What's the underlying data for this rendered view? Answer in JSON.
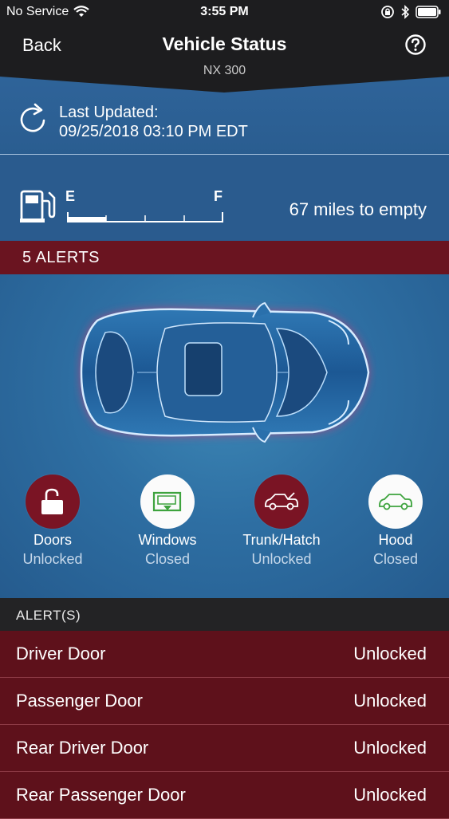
{
  "status_bar": {
    "carrier": "No Service",
    "time": "3:55 PM",
    "wifi_icon": "wifi-icon",
    "battery_icon": "battery-icon"
  },
  "header": {
    "back_label": "Back",
    "title": "Vehicle Status",
    "subtitle": "NX 300",
    "help_icon": "help-icon"
  },
  "updated": {
    "label": "Last Updated:",
    "value": "09/25/2018 03:10 PM EDT"
  },
  "fuel": {
    "empty_label": "E",
    "full_label": "F",
    "level": 0.25,
    "range_text": "67 miles to empty"
  },
  "alerts_banner": {
    "count_text": "5 ALERTS"
  },
  "statuses": [
    {
      "name": "Doors",
      "value": "Unlocked",
      "icon": "unlocked-padlock-icon",
      "state": "alert"
    },
    {
      "name": "Windows",
      "value": "Closed",
      "icon": "window-icon",
      "state": "ok"
    },
    {
      "name": "Trunk/Hatch",
      "value": "Unlocked",
      "icon": "car-trunk-icon",
      "state": "alert"
    },
    {
      "name": "Hood",
      "value": "Closed",
      "icon": "car-hood-icon",
      "state": "ok"
    }
  ],
  "alerts_list": {
    "header": "ALERT(S)",
    "items": [
      {
        "label": "Driver Door",
        "value": "Unlocked"
      },
      {
        "label": "Passenger Door",
        "value": "Unlocked"
      },
      {
        "label": "Rear Driver Door",
        "value": "Unlocked"
      },
      {
        "label": "Rear Passenger Door",
        "value": "Unlocked"
      }
    ]
  },
  "colors": {
    "alert_red": "#6a1420",
    "panel_blue": "#2a5c8c",
    "header_dark": "#1d1d1f"
  }
}
